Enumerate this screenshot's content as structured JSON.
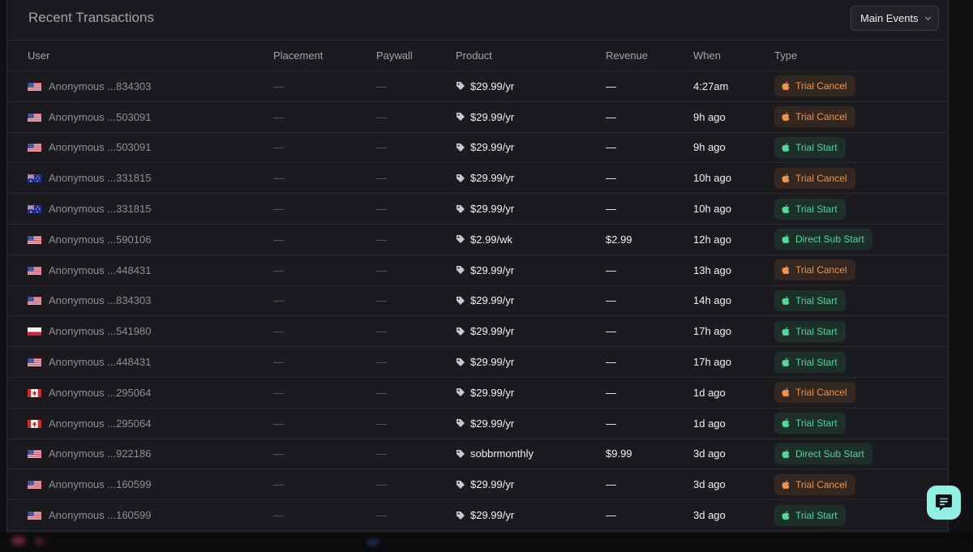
{
  "panel": {
    "title": "Recent Transactions",
    "filter_label": "Main Events"
  },
  "columns": {
    "user": "User",
    "placement": "Placement",
    "paywall": "Paywall",
    "product": "Product",
    "revenue": "Revenue",
    "when": "When",
    "type": "Type"
  },
  "rows": [
    {
      "flag": "us",
      "user": "Anonymous ...834303",
      "placement": "—",
      "paywall": "—",
      "product": "$29.99/yr",
      "revenue": "—",
      "when": "4:27am",
      "type": "Trial Cancel",
      "kind": "cancel"
    },
    {
      "flag": "us",
      "user": "Anonymous ...503091",
      "placement": "—",
      "paywall": "—",
      "product": "$29.99/yr",
      "revenue": "—",
      "when": "9h ago",
      "type": "Trial Cancel",
      "kind": "cancel"
    },
    {
      "flag": "us",
      "user": "Anonymous ...503091",
      "placement": "—",
      "paywall": "—",
      "product": "$29.99/yr",
      "revenue": "—",
      "when": "9h ago",
      "type": "Trial Start",
      "kind": "start"
    },
    {
      "flag": "au",
      "user": "Anonymous ...331815",
      "placement": "—",
      "paywall": "—",
      "product": "$29.99/yr",
      "revenue": "—",
      "when": "10h ago",
      "type": "Trial Cancel",
      "kind": "cancel"
    },
    {
      "flag": "au",
      "user": "Anonymous ...331815",
      "placement": "—",
      "paywall": "—",
      "product": "$29.99/yr",
      "revenue": "—",
      "when": "10h ago",
      "type": "Trial Start",
      "kind": "start"
    },
    {
      "flag": "us",
      "user": "Anonymous ...590106",
      "placement": "—",
      "paywall": "—",
      "product": "$2.99/wk",
      "revenue": "$2.99",
      "when": "12h ago",
      "type": "Direct Sub Start",
      "kind": "start"
    },
    {
      "flag": "us",
      "user": "Anonymous ...448431",
      "placement": "—",
      "paywall": "—",
      "product": "$29.99/yr",
      "revenue": "—",
      "when": "13h ago",
      "type": "Trial Cancel",
      "kind": "cancel"
    },
    {
      "flag": "us",
      "user": "Anonymous ...834303",
      "placement": "—",
      "paywall": "—",
      "product": "$29.99/yr",
      "revenue": "—",
      "when": "14h ago",
      "type": "Trial Start",
      "kind": "start"
    },
    {
      "flag": "pl",
      "user": "Anonymous ...541980",
      "placement": "—",
      "paywall": "—",
      "product": "$29.99/yr",
      "revenue": "—",
      "when": "17h ago",
      "type": "Trial Start",
      "kind": "start"
    },
    {
      "flag": "us",
      "user": "Anonymous ...448431",
      "placement": "—",
      "paywall": "—",
      "product": "$29.99/yr",
      "revenue": "—",
      "when": "17h ago",
      "type": "Trial Start",
      "kind": "start"
    },
    {
      "flag": "ca",
      "user": "Anonymous ...295064",
      "placement": "—",
      "paywall": "—",
      "product": "$29.99/yr",
      "revenue": "—",
      "when": "1d ago",
      "type": "Trial Cancel",
      "kind": "cancel"
    },
    {
      "flag": "ca",
      "user": "Anonymous ...295064",
      "placement": "—",
      "paywall": "—",
      "product": "$29.99/yr",
      "revenue": "—",
      "when": "1d ago",
      "type": "Trial Start",
      "kind": "start"
    },
    {
      "flag": "us",
      "user": "Anonymous ...922186",
      "placement": "—",
      "paywall": "—",
      "product": "sobbrmonthly",
      "revenue": "$9.99",
      "when": "3d ago",
      "type": "Direct Sub Start",
      "kind": "start"
    },
    {
      "flag": "us",
      "user": "Anonymous ...160599",
      "placement": "—",
      "paywall": "—",
      "product": "$29.99/yr",
      "revenue": "—",
      "when": "3d ago",
      "type": "Trial Cancel",
      "kind": "cancel"
    },
    {
      "flag": "us",
      "user": "Anonymous ...160599",
      "placement": "—",
      "paywall": "—",
      "product": "$29.99/yr",
      "revenue": "—",
      "when": "3d ago",
      "type": "Trial Start",
      "kind": "start"
    }
  ],
  "colors": {
    "cancel": "#f0934a",
    "start": "#4fd89a",
    "chat_button": "#8ff0e4"
  },
  "icons": {
    "product": "tag-icon",
    "type": "apple-icon",
    "filter": "chevron-down-icon",
    "chat": "chat-icon"
  }
}
